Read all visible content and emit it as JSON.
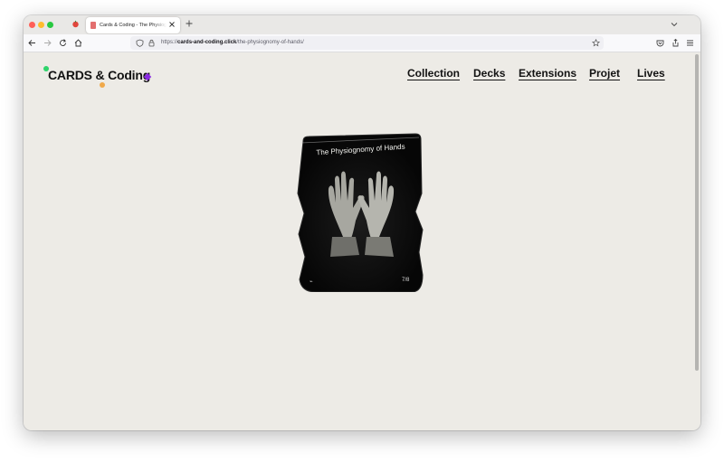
{
  "browser": {
    "tab": {
      "title": "Cards & Coding - The Physiognomy of Hands"
    },
    "url": {
      "prefix": "https://",
      "domain": "cards-and-coding.click",
      "path": "/the-physiognomy-of-hands/"
    }
  },
  "site": {
    "logo": "CARDS & Coding",
    "nav": [
      "Collection",
      "Decks",
      "Extensions",
      "Projet",
      "Lives"
    ]
  },
  "card": {
    "title": "The Physiognomy of Hands",
    "symbol": "⌁",
    "number": "7/8"
  },
  "colors": {
    "page_bg": "#edebe6",
    "accent_green": "#2fd46b",
    "accent_orange": "#f0a94a",
    "accent_purple": "#8a2be2"
  }
}
